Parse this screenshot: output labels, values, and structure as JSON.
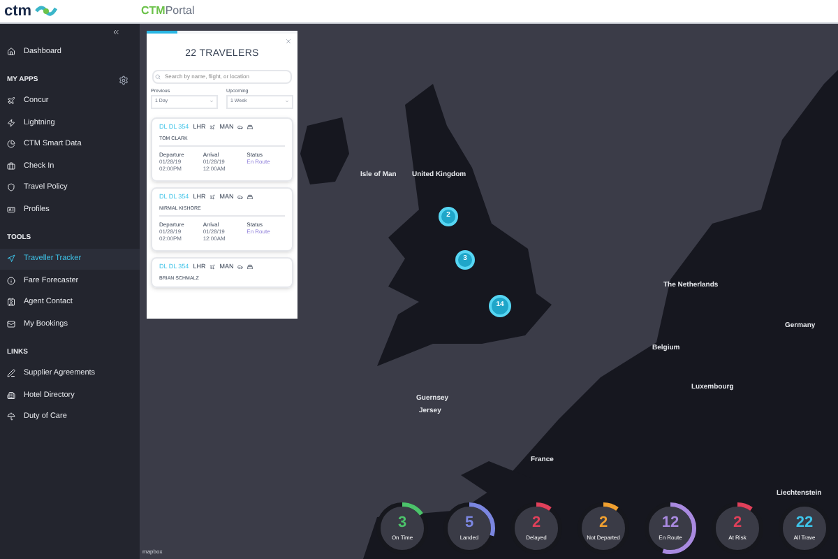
{
  "header": {
    "logo": "ctm",
    "brand": {
      "accent": "CTM",
      "rest": "Portal"
    }
  },
  "sidebar": {
    "sections": [
      {
        "items": [
          {
            "label": "Dashboard",
            "selected": false
          }
        ]
      },
      {
        "heading": "MY APPS",
        "items": [
          {
            "label": "Concur",
            "selected": false
          },
          {
            "label": "Lightning",
            "selected": false
          },
          {
            "label": "CTM Smart Data",
            "selected": false
          },
          {
            "label": "Check In",
            "selected": false
          },
          {
            "label": "Travel Policy",
            "selected": false
          },
          {
            "label": "Profiles",
            "selected": false
          }
        ]
      },
      {
        "heading": "TOOLS",
        "items": [
          {
            "label": "Traveller Tracker",
            "selected": true
          },
          {
            "label": "Fare Forecaster",
            "selected": false
          },
          {
            "label": "Agent Contact",
            "selected": false
          },
          {
            "label": "My Bookings",
            "selected": false
          }
        ]
      },
      {
        "heading": "LINKS",
        "items": [
          {
            "label": "Supplier Agreements",
            "selected": false
          },
          {
            "label": "Hotel Directory",
            "selected": false
          },
          {
            "label": "Duty of Care",
            "selected": false
          }
        ]
      }
    ]
  },
  "panel": {
    "title": "22 TRAVELERS",
    "level": 0.2,
    "search": {
      "placeholder": "Search by name, flight, or location"
    },
    "filters": [
      {
        "label": "Previous",
        "value": "1 Day"
      },
      {
        "label": "Upcoming",
        "value": "1 Week"
      }
    ],
    "cards": [
      {
        "flight": "DL DL 354",
        "from": "LHR",
        "to": "MAN",
        "name": "TOM CLARK",
        "details": [
          {
            "label": "Departure",
            "date": "01/28/19",
            "time": "02:00PM"
          },
          {
            "label": "Arrival",
            "date": "01/28/19",
            "time": "12:00AM"
          },
          {
            "label": "Status",
            "status": "En Route"
          }
        ]
      },
      {
        "flight": "DL DL 354",
        "from": "LHR",
        "to": "MAN",
        "name": "NIRMAL KISHORE",
        "details": [
          {
            "label": "Departure",
            "date": "01/28/19",
            "time": "02:00PM"
          },
          {
            "label": "Arrival",
            "date": "01/28/19",
            "time": "12:00AM"
          },
          {
            "label": "Status",
            "status": "En Route"
          }
        ]
      },
      {
        "flight": "DL DL 354",
        "from": "LHR",
        "to": "MAN",
        "name": "BRIAN SCHMALZ"
      }
    ]
  },
  "map": {
    "labels": [
      "Isle of Man",
      "United Kingdom",
      "The Netherlands",
      "Belgium",
      "Luxembourg",
      "Germany",
      "Guernsey",
      "Jersey",
      "France",
      "Liechtenstein"
    ],
    "clusters": [
      "2",
      "3",
      "14"
    ],
    "attribution": "mapbox"
  },
  "stats": [
    {
      "value": "3",
      "label": "On Time",
      "color": "#4cc36b",
      "level": 0.15
    },
    {
      "value": "5",
      "label": "Landed",
      "color": "#7b86e0",
      "level": 0.3
    },
    {
      "value": "2",
      "label": "Delayed",
      "color": "#e0405a",
      "level": 0.1
    },
    {
      "value": "2",
      "label": "Not Departed",
      "color": "#f0a030",
      "level": 0.1
    },
    {
      "value": "12",
      "label": "En Route",
      "color": "#a98ae0",
      "level": 0.55
    },
    {
      "value": "2",
      "label": "At Risk",
      "color": "#e0405a",
      "level": 0.1
    },
    {
      "value": "22",
      "label": "All Trave",
      "color": "#3ec3e8"
    }
  ]
}
